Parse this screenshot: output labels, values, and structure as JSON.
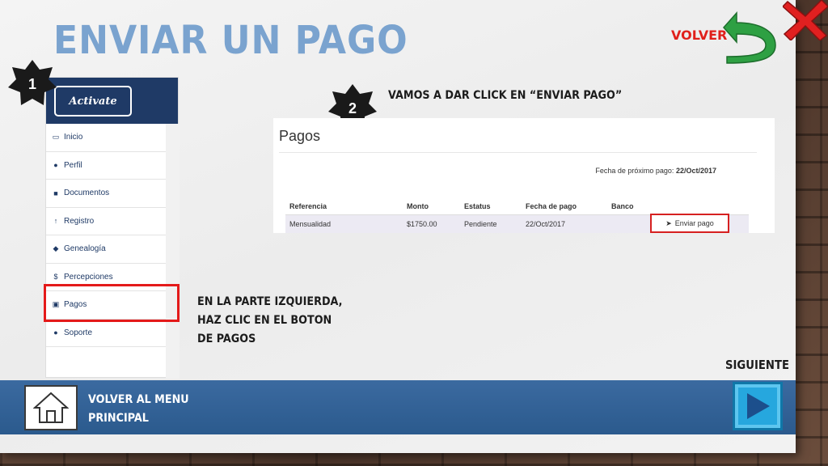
{
  "title": "ENVIAR UN PAGO",
  "volver_label": "VOLVER",
  "sidebar": {
    "logo": "Activate",
    "items": [
      {
        "label": "Inicio",
        "icon": "monitor-icon"
      },
      {
        "label": "Perfil",
        "icon": "user-icon"
      },
      {
        "label": "Documentos",
        "icon": "briefcase-icon"
      },
      {
        "label": "Registro",
        "icon": "tree-icon"
      },
      {
        "label": "Genealogía",
        "icon": "users-icon"
      },
      {
        "label": "Percepciones",
        "icon": "dollar-icon"
      },
      {
        "label": "Pagos",
        "icon": "money-icon"
      },
      {
        "label": "Soporte",
        "icon": "comments-icon"
      }
    ]
  },
  "badges": {
    "step1": "1",
    "step2": "2"
  },
  "instructions": {
    "step1_lines": [
      "EN LA PARTE IZQUIERDA,",
      "HAZ CLIC EN EL BOTON",
      "DE PAGOS"
    ],
    "step2": "VAMOS A DAR CLICK EN “ENVIAR PAGO”"
  },
  "payments": {
    "title": "Pagos",
    "next_payment_label": "Fecha de próximo pago:",
    "next_payment_date": "22/Oct/2017",
    "columns": [
      "Referencia",
      "Monto",
      "Estatus",
      "Fecha de pago",
      "Banco"
    ],
    "rows": [
      {
        "referencia": "Mensualidad",
        "monto": "$1750.00",
        "estatus": "Pendiente",
        "fecha": "22/Oct/2017",
        "banco": ""
      }
    ],
    "send_button": "Enviar pago"
  },
  "siguiente_label": "SIGUIENTE",
  "bottom": {
    "menu_lines": [
      "VOLVER AL MENU",
      "PRINCIPAL"
    ]
  },
  "colors": {
    "title": "#7aa3cf",
    "accent_red": "#e41a1a",
    "navy": "#1f3a66",
    "bar_blue": "#2b5a8d",
    "next_blue": "#26a7de"
  }
}
